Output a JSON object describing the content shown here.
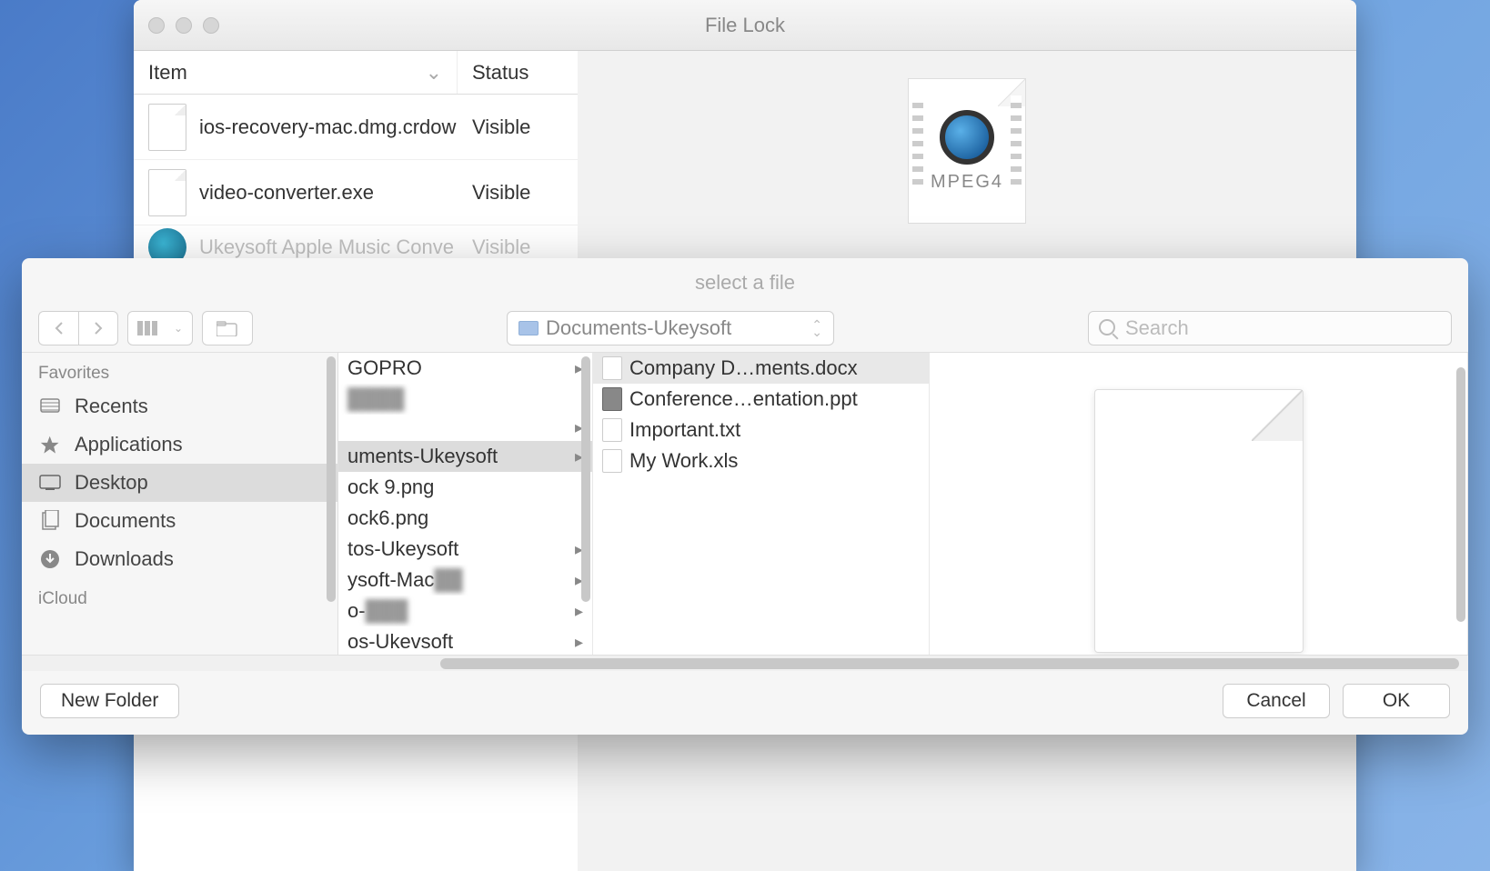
{
  "bg_window": {
    "title": "File Lock",
    "headers": {
      "item": "Item",
      "status": "Status"
    },
    "rows": [
      {
        "name": "ios-recovery-mac.dmg.crdow",
        "status": "Visible",
        "icon": "file"
      },
      {
        "name": "video-converter.exe",
        "status": "Visible",
        "icon": "file"
      },
      {
        "name": "Ukeysoft Apple Music Conve",
        "status": "Visible",
        "icon": "app"
      }
    ],
    "preview_label": "MPEG4"
  },
  "dialog": {
    "title": "select a file",
    "path_label": "Documents-Ukeysoft",
    "search_placeholder": "Search",
    "sidebar": {
      "sections": [
        {
          "label": "Favorites",
          "items": [
            {
              "label": "Recents",
              "icon": "recents"
            },
            {
              "label": "Applications",
              "icon": "apps"
            },
            {
              "label": "Desktop",
              "icon": "desktop",
              "selected": true
            },
            {
              "label": "Documents",
              "icon": "docs"
            },
            {
              "label": "Downloads",
              "icon": "downloads"
            }
          ]
        },
        {
          "label": "iCloud",
          "items": []
        }
      ]
    },
    "col1": [
      {
        "label": "GOPRO",
        "arrow": true
      },
      {
        "label": "blur1",
        "arrow": false,
        "blur": true
      },
      {
        "label": "",
        "arrow": true
      },
      {
        "label": "uments-Ukeysoft",
        "arrow": true,
        "selected": true
      },
      {
        "label": "ock 9.png",
        "arrow": false
      },
      {
        "label": "ock6.png",
        "arrow": false
      },
      {
        "label": "tos-Ukeysoft",
        "arrow": true
      },
      {
        "label": "ysoft-Mac",
        "arrow": true,
        "blur_tail": true
      },
      {
        "label": "o-",
        "arrow": true,
        "blur_tail": true
      },
      {
        "label": "os-Ukevsoft",
        "arrow": true
      }
    ],
    "col2": [
      {
        "label": "Company D…ments.docx",
        "icon": "file",
        "selected": true
      },
      {
        "label": "Conference…entation.ppt",
        "icon": "dark"
      },
      {
        "label": "Important.txt",
        "icon": "file"
      },
      {
        "label": "My Work.xls",
        "icon": "file"
      }
    ],
    "footer": {
      "new_folder": "New Folder",
      "cancel": "Cancel",
      "ok": "OK"
    }
  }
}
